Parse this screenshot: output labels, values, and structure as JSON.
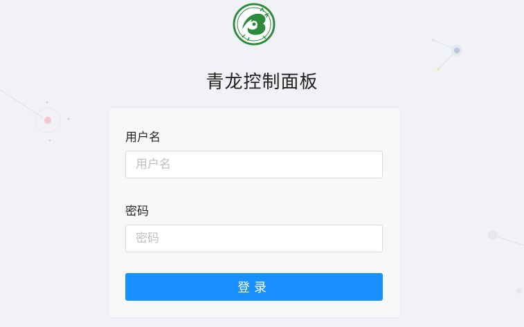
{
  "app": {
    "title": "青龙控制面板"
  },
  "form": {
    "username_label": "用户名",
    "username_placeholder": "用户名",
    "username_value": "",
    "password_label": "密码",
    "password_placeholder": "密码",
    "password_value": "",
    "login_label": "登录"
  },
  "colors": {
    "background": "#f0f2f5",
    "card": "#f7f8fa",
    "primary": "#1890ff",
    "logo_green": "#2e8b3e"
  },
  "icons": {
    "logo": "dragon-logo-icon"
  }
}
